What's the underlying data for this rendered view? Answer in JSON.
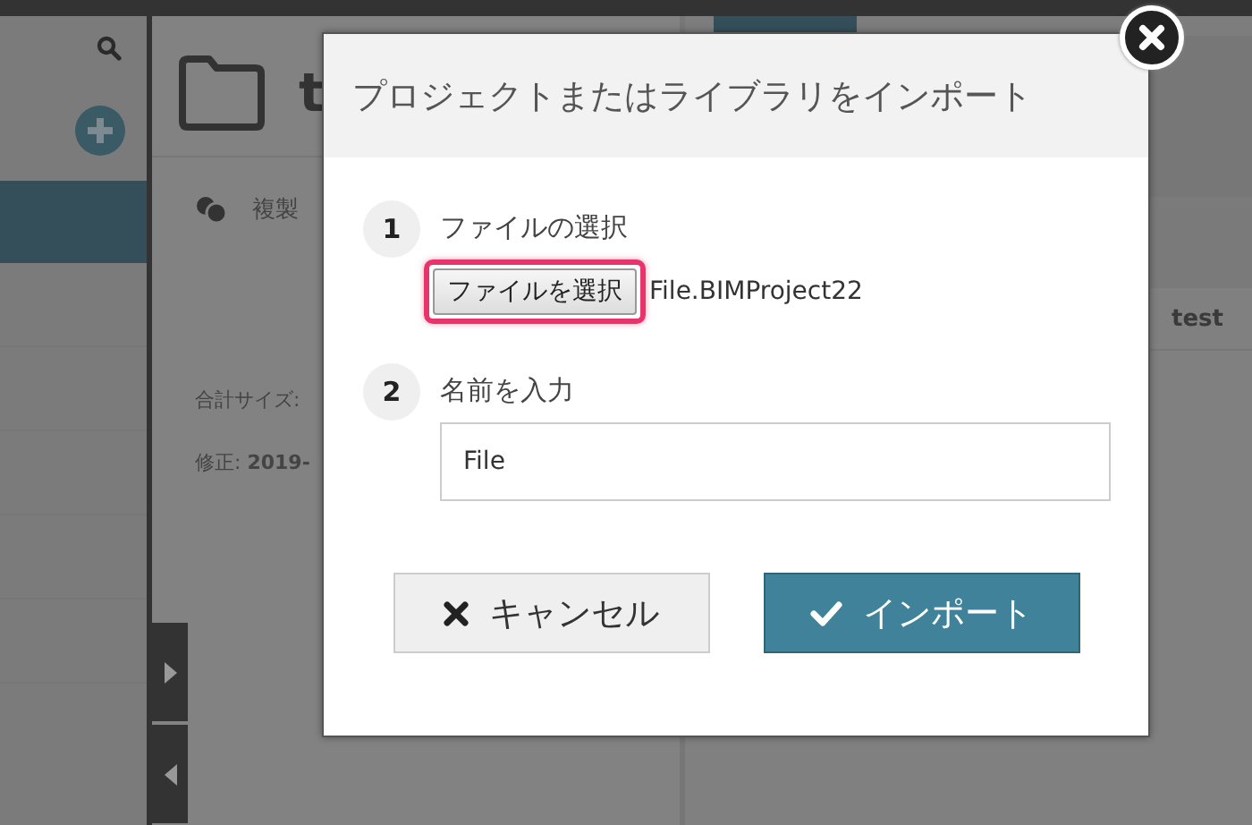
{
  "main": {
    "title": "t",
    "actions": [
      {
        "label": "複製"
      }
    ],
    "details": [
      "合計サイズ:",
      "修正: **2019-**"
    ]
  },
  "right_panel": {
    "column_1": "test"
  },
  "dialog": {
    "title": "プロジェクトまたはライブラリをインポート",
    "steps": [
      {
        "number": "1",
        "label": "ファイルの選択",
        "kind": "file",
        "button": "ファイルを選択",
        "file_name": "File.BIMProject22",
        "highlighted": true
      },
      {
        "number": "2",
        "label": "名前を入力",
        "kind": "text",
        "value": "File"
      }
    ],
    "buttons": [
      {
        "label": "キャンセル",
        "kind": "cancel"
      },
      {
        "label": "インポート",
        "kind": "primary"
      }
    ]
  }
}
